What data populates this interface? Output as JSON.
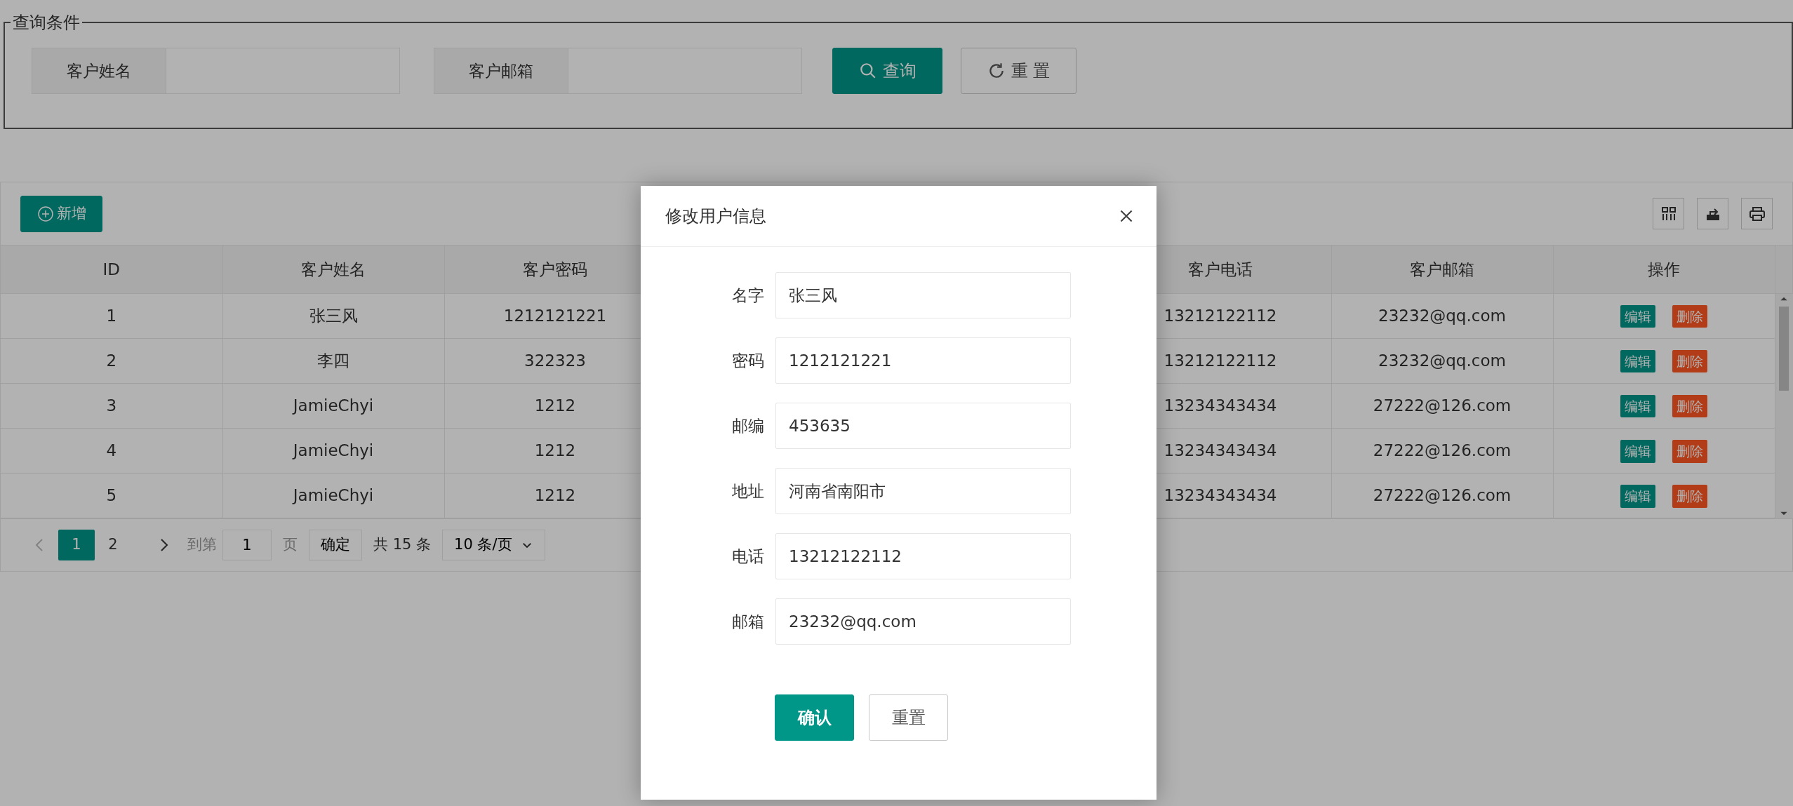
{
  "query_panel": {
    "legend": "查询条件",
    "fields": [
      {
        "label": "客户姓名"
      },
      {
        "label": "客户邮箱"
      }
    ],
    "buttons": [
      {
        "label": "查询",
        "kind": "primary"
      },
      {
        "label": "重 置",
        "kind": "default"
      }
    ]
  },
  "table": {
    "add_button": "新增",
    "columns": [
      "ID",
      "客户姓名",
      "客户密码",
      "客户电话",
      "客户邮箱",
      "操作"
    ],
    "rows": [
      {
        "cells": [
          "1",
          "张三风",
          "1212121221",
          "13212122112",
          "23232@qq.com"
        ],
        "actions": [
          {
            "label": "编辑",
            "kind": "edit"
          },
          {
            "label": "删除",
            "kind": "delete"
          }
        ]
      },
      {
        "cells": [
          "2",
          "李四",
          "322323",
          "13212122112",
          "23232@qq.com"
        ],
        "actions": [
          {
            "label": "编辑",
            "kind": "edit"
          },
          {
            "label": "删除",
            "kind": "delete"
          }
        ]
      },
      {
        "cells": [
          "3",
          "JamieChyi",
          "1212",
          "13234343434",
          "27222@126.com"
        ],
        "actions": [
          {
            "label": "编辑",
            "kind": "edit"
          },
          {
            "label": "删除",
            "kind": "delete"
          }
        ]
      },
      {
        "cells": [
          "4",
          "JamieChyi",
          "1212",
          "13234343434",
          "27222@126.com"
        ],
        "actions": [
          {
            "label": "编辑",
            "kind": "edit"
          },
          {
            "label": "删除",
            "kind": "delete"
          }
        ]
      },
      {
        "cells": [
          "5",
          "JamieChyi",
          "1212",
          "13234343434",
          "27222@126.com"
        ],
        "actions": [
          {
            "label": "编辑",
            "kind": "edit"
          },
          {
            "label": "删除",
            "kind": "delete"
          }
        ]
      }
    ]
  },
  "pagination": {
    "prev": {
      "disabled": true
    },
    "pages": [
      {
        "label": "1",
        "selected": true
      },
      {
        "label": "2",
        "selected": false
      }
    ],
    "next": {
      "disabled": false
    },
    "goto_label": "到第",
    "goto_value": "1",
    "page_unit": "页",
    "confirm": "确定",
    "total": "共 15 条",
    "page_size": "10 条/页"
  },
  "dialog": {
    "title": "修改用户信息",
    "fields": [
      {
        "label": "名字",
        "value": "张三风"
      },
      {
        "label": "密码",
        "value": "1212121221"
      },
      {
        "label": "邮编",
        "value": "453635"
      },
      {
        "label": "地址",
        "value": "河南省南阳市"
      },
      {
        "label": "电话",
        "value": "13212122112"
      },
      {
        "label": "邮箱",
        "value": "23232@qq.com"
      }
    ],
    "buttons": [
      {
        "label": "确认",
        "kind": "primary"
      },
      {
        "label": "重置",
        "kind": "default"
      }
    ]
  }
}
